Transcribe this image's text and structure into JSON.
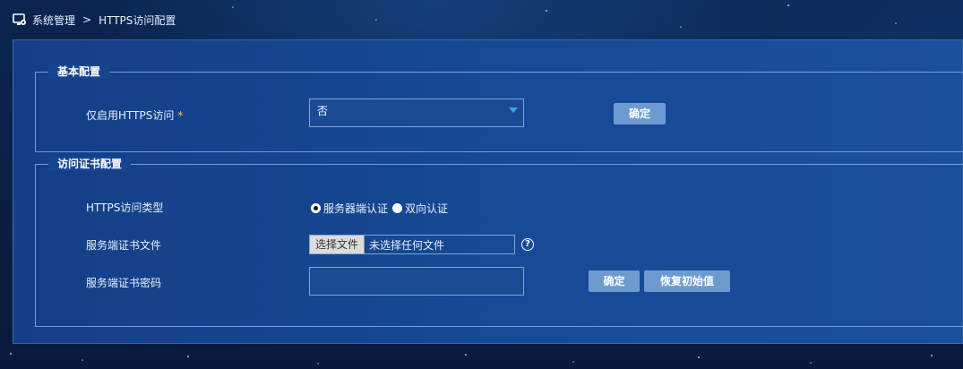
{
  "breadcrumb": {
    "section": "系统管理",
    "separator": ">",
    "page": "HTTPS访问配置"
  },
  "basic_config": {
    "legend": "基本配置",
    "https_only_label": "仅启用HTTPS访问",
    "required_mark": "*",
    "https_only_value": "否",
    "confirm_label": "确定"
  },
  "cert_config": {
    "legend": "访问证书配置",
    "access_type_label": "HTTPS访问类型",
    "access_type_options": [
      "服务器端认证",
      "双向认证"
    ],
    "access_type_selected": "服务器端认证",
    "cert_file_label": "服务端证书文件",
    "choose_file_label": "选择文件",
    "no_file_text": "未选择任何文件",
    "help_icon_text": "?",
    "cert_password_label": "服务端证书密码",
    "cert_password_value": "",
    "confirm_label": "确定",
    "restore_label": "恢复初始值"
  },
  "colors": {
    "background": "#0a2048",
    "panel": "#164590",
    "button": "#6d9bd0",
    "required": "#f6c344",
    "caret": "#3fa7e0"
  }
}
